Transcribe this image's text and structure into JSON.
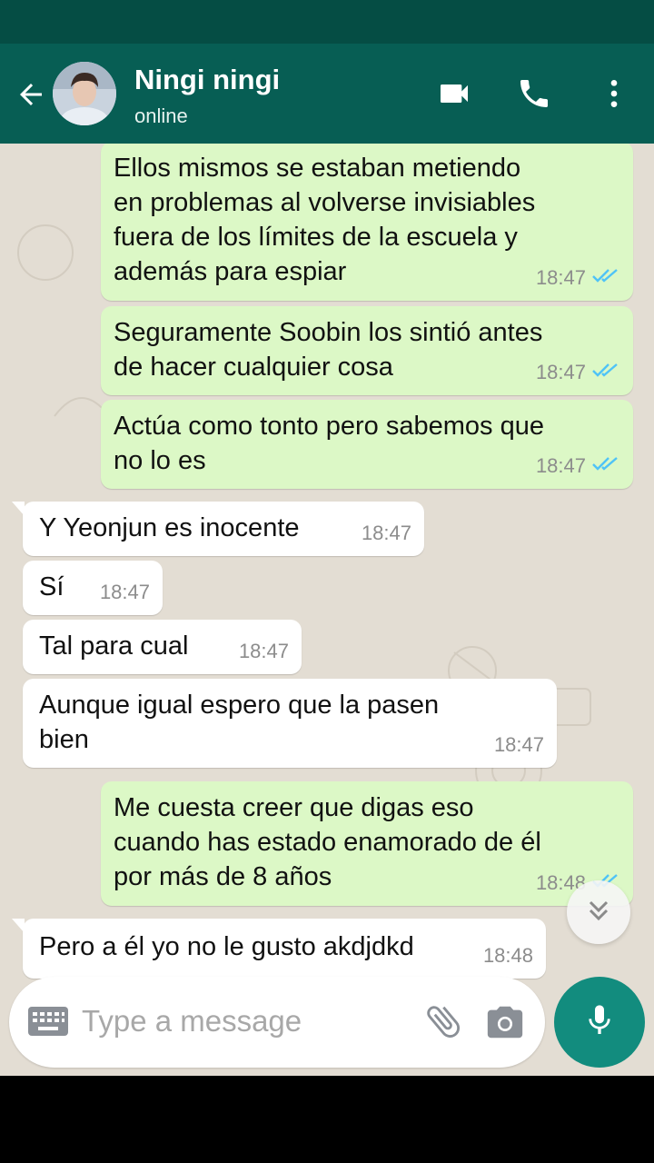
{
  "header": {
    "contact_name": "Ningi ningi",
    "status": "online",
    "icons": [
      "back-arrow-icon",
      "video-call-icon",
      "phone-icon",
      "more-vert-icon"
    ]
  },
  "messages": [
    {
      "direction": "out",
      "text": "Ellos mismos se estaban metiendo\nen problemas al volverse invisiables\nfuera de los límites de la escuela y\nademás para espiar",
      "time": "18:47",
      "read": true
    },
    {
      "direction": "out",
      "text": "Seguramente Soobin los sintió antes\nde hacer cualquier cosa",
      "time": "18:47",
      "read": true
    },
    {
      "direction": "out",
      "text": "Actúa como tonto pero sabemos que\nno lo es",
      "time": "18:47",
      "read": true
    },
    {
      "direction": "in",
      "text": "Y Yeonjun es inocente",
      "time": "18:47"
    },
    {
      "direction": "in",
      "text": "Sí",
      "time": "18:47"
    },
    {
      "direction": "in",
      "text": "Tal para cual",
      "time": "18:47"
    },
    {
      "direction": "in",
      "text": "Aunque igual espero que la pasen\nbien",
      "time": "18:47"
    },
    {
      "direction": "out",
      "text": "Me cuesta creer que digas eso\ncuando has estado enamorado de él\npor más de 8 años",
      "time": "18:48",
      "read": true
    },
    {
      "direction": "in",
      "text": "Pero a él yo no le gusto akdjdkd",
      "time": "18:48"
    }
  ],
  "composer": {
    "placeholder": "Type a message",
    "icons": [
      "keyboard-icon",
      "attach-icon",
      "camera-icon",
      "mic-icon"
    ]
  },
  "colors": {
    "header": "#075e54",
    "outgoing_bubble": "#dcf8c6",
    "incoming_bubble": "#ffffff",
    "read_ticks": "#4fc3f7",
    "mic_button": "#128c7e"
  }
}
